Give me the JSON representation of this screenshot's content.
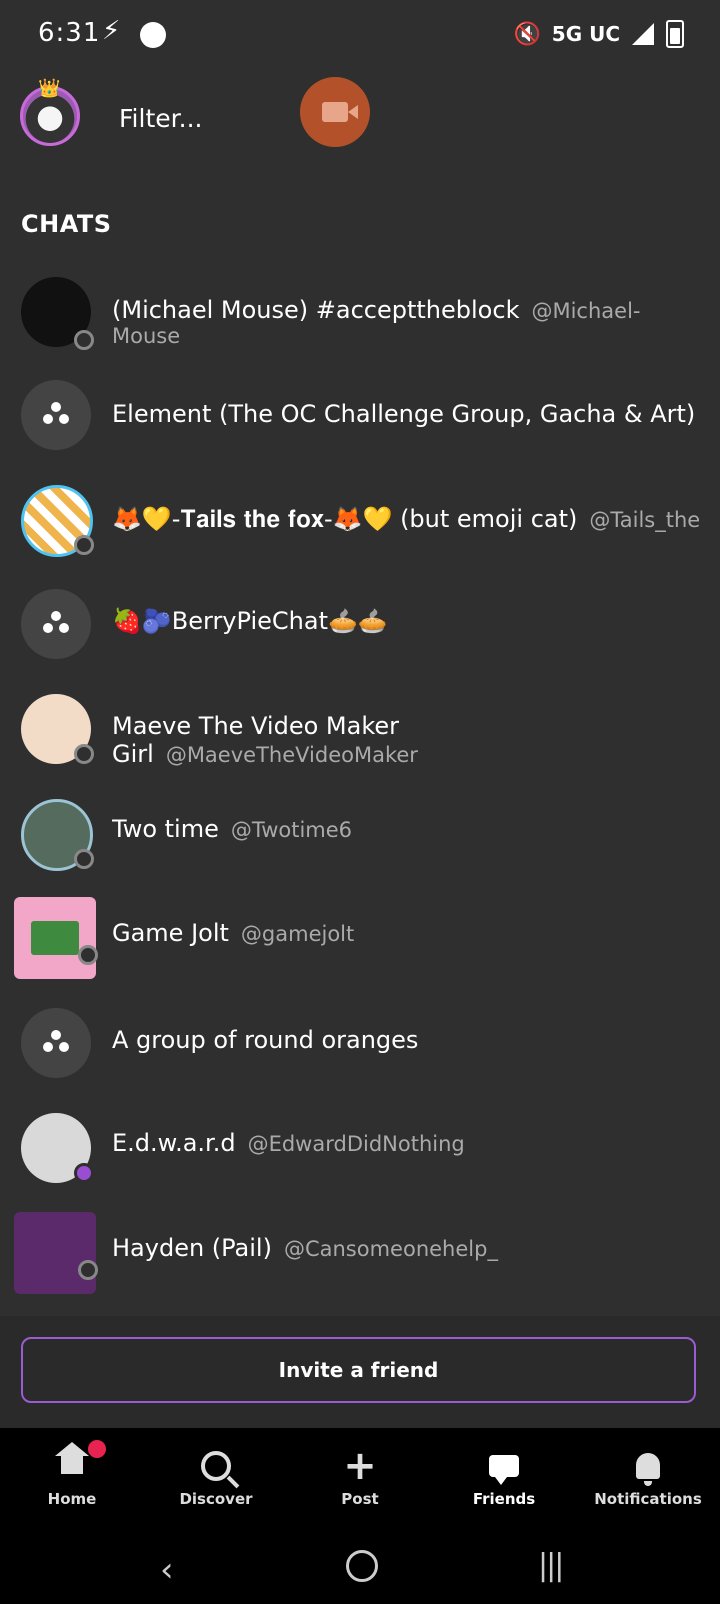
{
  "status_bar": {
    "time": "6:31",
    "network": "5G UC"
  },
  "top": {
    "filter_placeholder": "Filter...",
    "video_icon": "video-camera-icon"
  },
  "section_title": "CHATS",
  "chats": [
    {
      "name": "(Michael Mouse) #accepttheblock",
      "handle": "@Michael-Mouse",
      "type": "user"
    },
    {
      "name": "Element (The OC Challenge Group, Gacha & Art)",
      "handle": "",
      "type": "group"
    },
    {
      "name": "🦊💛-𝐓𝐚𝐢𝐥𝐬 𝐭𝐡𝐞 𝐟𝐨𝐱-🦊💛 (but emoji cat)",
      "handle": "@Tails_the",
      "type": "user"
    },
    {
      "name": "🍓🫐BerryPieChat🥧🥧",
      "handle": "",
      "type": "group"
    },
    {
      "name": "Maeve The Video Maker Girl",
      "handle": "@MaeveTheVideoMaker",
      "type": "user"
    },
    {
      "name": "Two time",
      "handle": "@Twotime6",
      "type": "user"
    },
    {
      "name": "Game Jolt",
      "handle": "@gamejolt",
      "type": "user"
    },
    {
      "name": "A group of round oranges",
      "handle": "",
      "type": "group"
    },
    {
      "name": "E.d.w.a.r.d",
      "handle": "@EdwardDidNothing",
      "type": "user"
    },
    {
      "name": "Hayden (Pail)",
      "handle": "@Cansomeonehelp_",
      "type": "user"
    }
  ],
  "invite_label": "Invite a friend",
  "nav": {
    "home": "Home",
    "discover": "Discover",
    "post": "Post",
    "friends": "Friends",
    "notifications": "Notifications"
  },
  "colors": {
    "accent": "#9b5bd1",
    "video": "#b3522a",
    "badge": "#e8234f"
  }
}
